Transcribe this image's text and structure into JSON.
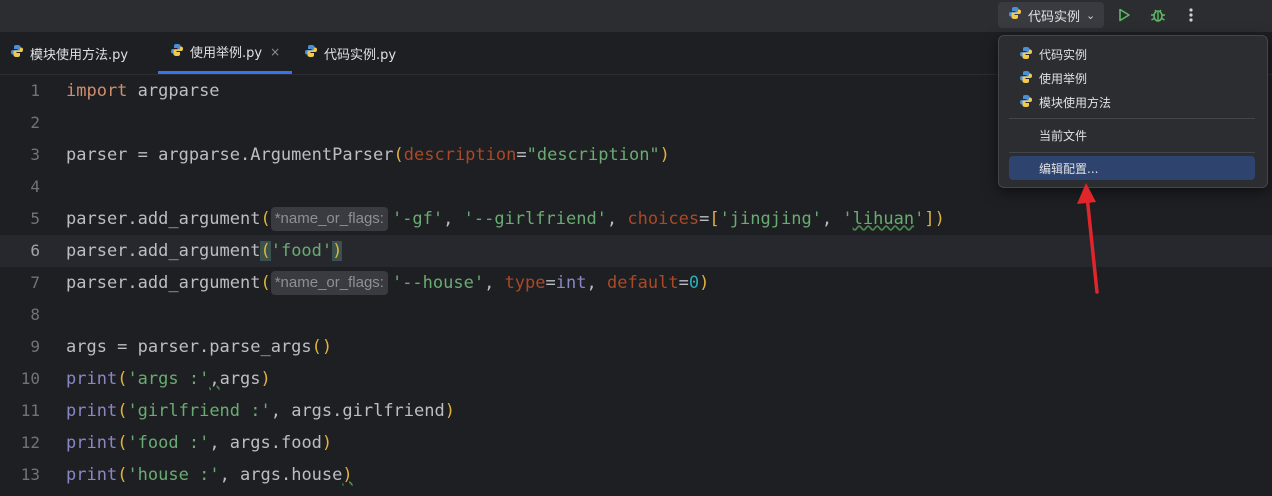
{
  "toolbar": {
    "run_config_label": "代码实例",
    "run_config_icon": "python-icon",
    "run_icon": "run-icon",
    "debug_icon": "debug-icon",
    "more_icon": "more-vertical-icon"
  },
  "tabs": [
    {
      "label": "模块使用方法.py",
      "active": false
    },
    {
      "label": "使用举例.py",
      "active": true,
      "close": "×"
    },
    {
      "label": "代码实例.py",
      "active": false
    }
  ],
  "editor": {
    "line_numbers": [
      "1",
      "2",
      "3",
      "4",
      "5",
      "6",
      "7",
      "8",
      "9",
      "10",
      "11",
      "12",
      "13"
    ],
    "current_line": "6",
    "inlay_hint": "*name_or_flags:"
  },
  "dropdown": {
    "items": [
      "代码实例",
      "使用举例",
      "模块使用方法"
    ],
    "current_file": "当前文件",
    "edit_config": "编辑配置..."
  },
  "colors": {
    "accent": "#3574f0",
    "keyword": "#cf8e6d",
    "string": "#6aab73",
    "number": "#2aacb8",
    "param": "#aa4926",
    "annotation_arrow": "#e0262a"
  }
}
